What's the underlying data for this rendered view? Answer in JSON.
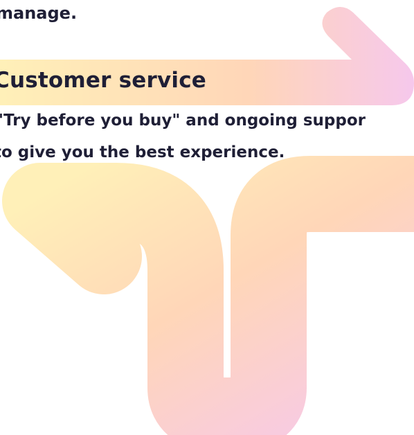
{
  "text": {
    "fragment_tail": "manage.",
    "section_heading": "Customer service",
    "body_line_1": "\"Try before you buy\" and ongoing suppor",
    "body_line_2": "to give you the best experience."
  },
  "decor": {
    "gradient_start": "#fff0b8",
    "gradient_mid": "#ffd6b8",
    "gradient_end": "#f6c8ec"
  }
}
